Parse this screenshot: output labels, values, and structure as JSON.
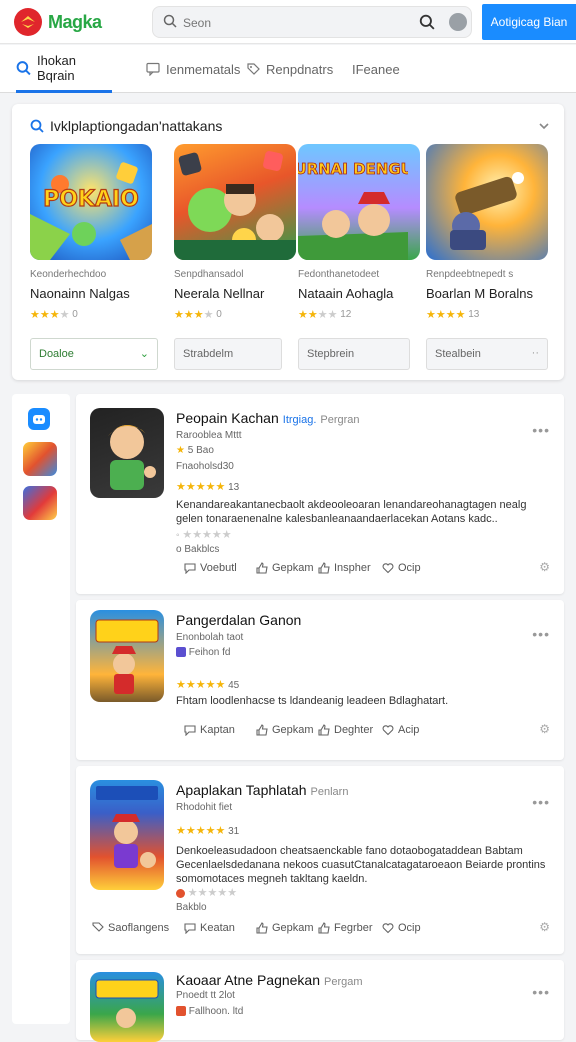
{
  "brand": {
    "name": "Magka"
  },
  "search": {
    "placeholder": "Seon"
  },
  "cta": {
    "label": "Aotigicag Bian"
  },
  "tabs": [
    {
      "label": "Ihokan Bqrain",
      "active": true
    },
    {
      "label": "Ienmematals"
    },
    {
      "label": "Renpdnatrs"
    },
    {
      "label": "IFeanee"
    }
  ],
  "recommend": {
    "heading": "Ivklplaptiongadan'nattakans",
    "cards": [
      {
        "category": "Keonderhechdoo",
        "name": "Naonainn Nalgas",
        "rating_text": "0",
        "stars": 3,
        "button": "Doaloe",
        "thumb_text": "POKAIO"
      },
      {
        "category": "Senpdhansadol",
        "name": "Neerala Nellnar",
        "rating_text": "0",
        "stars": 3,
        "button": "Strabdelm",
        "thumb_text": ""
      },
      {
        "category": "Fedonthanetodeet",
        "name": "Nataain Aohagla",
        "rating_text": "12",
        "stars": 2,
        "button": "Stepbrein",
        "thumb_text": "SURNAI DENGUL"
      },
      {
        "category": "Renpdeebtnepedt s",
        "name": "Boarlan M Boralns",
        "rating_text": "13",
        "stars": 4,
        "button": "Stealbein",
        "thumb_text": ""
      }
    ]
  },
  "feed": [
    {
      "title": "Peopain Kachan",
      "tag": "Itrgiag.",
      "genre": "Pergran",
      "meta1": "Rarooblea Mttt",
      "meta2": "5 Bao",
      "meta3": "Fnaoholsd30",
      "rating_text": "13",
      "stars": 5,
      "desc": "Kenandareakantanecbaolt akdeooleoaran lenandareohanagtagen nealg gelen tonaraenenalne kalesbanleanaandaerlacekan Aotans kadc..",
      "meta4": "o Bakblcs",
      "actions": [
        "Voebutl",
        "Gepkam",
        "Inspher",
        "Ocip"
      ]
    },
    {
      "title": "Pangerdalan Ganon",
      "tag": "",
      "genre": "",
      "meta1": "Enonbolah taot",
      "meta2": "Feihon fd",
      "meta3": "",
      "rating_text": "45",
      "stars": 5,
      "desc": "Fhtam loodlenhacse ts ldandeanig leadeen Bdlaghatart.",
      "meta4": "",
      "actions": [
        "Kaptan",
        "Gepkam",
        "Deghter",
        "Acip"
      ]
    },
    {
      "title": "Apaplakan Taphlatah",
      "tag": "",
      "genre": "Penlarn",
      "meta1": "Rhodohit fiet",
      "meta2": "",
      "meta3": "",
      "rating_text": "31",
      "stars": 5,
      "desc": "Denkoeleasudadoon cheatsaenckable fano dotaobogataddean Babtam Gecenlaelsdedanana nekoos cuasutCtanalcatagataroeaon Beiarde prontins somomotaces megneh takltang kaeldn.",
      "meta4": "Bakblo",
      "actions": [
        "Saoflangens",
        "Keatan",
        "Gepkam",
        "Fegrber",
        "Ocip"
      ]
    },
    {
      "title": "Kaoaar Atne Pagnekan",
      "tag": "",
      "genre": "Pergam",
      "meta1": "Pnoedt tt 2lot",
      "meta2": "Fallhoon. ltd",
      "meta3": "",
      "rating_text": "",
      "stars": 0,
      "desc": "",
      "meta4": "",
      "actions": []
    }
  ]
}
